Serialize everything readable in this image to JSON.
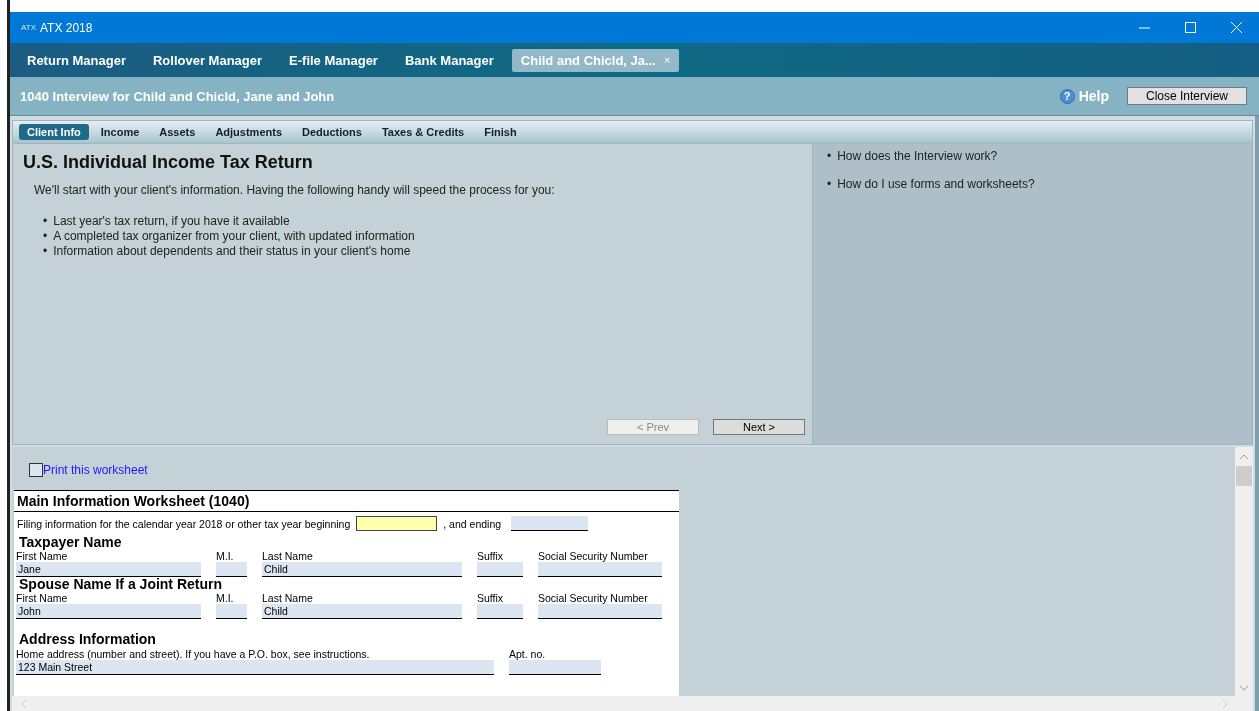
{
  "window": {
    "logo_text": "ATX",
    "title": "ATX 2018"
  },
  "tabs": [
    {
      "label": "Return Manager",
      "selected": false,
      "closable": false
    },
    {
      "label": "Rollover Manager",
      "selected": false,
      "closable": false
    },
    {
      "label": "E-file Manager",
      "selected": false,
      "closable": false
    },
    {
      "label": "Bank Manager",
      "selected": false,
      "closable": false
    },
    {
      "label": "Child and Chicld, Ja...",
      "selected": true,
      "closable": true,
      "close_label": "×"
    }
  ],
  "interview": {
    "title": "1040 Interview for Child and Chicld, Jane and John",
    "help_icon": "?",
    "help": "Help",
    "close_button": "Close Interview"
  },
  "section_tabs": [
    {
      "label": "Client Info",
      "selected": true
    },
    {
      "label": "Income",
      "selected": false
    },
    {
      "label": "Assets",
      "selected": false
    },
    {
      "label": "Adjustments",
      "selected": false
    },
    {
      "label": "Deductions",
      "selected": false
    },
    {
      "label": "Taxes & Credits",
      "selected": false
    },
    {
      "label": "Finish",
      "selected": false
    }
  ],
  "intro": {
    "heading": "U.S. Individual Income Tax Return",
    "text": "We'll start with your client's information. Having the following handy will speed the process for you:",
    "bullet_marker": "•",
    "bullets": [
      "Last year's tax return, if you have it available",
      "A completed tax organizer from your client, with updated information",
      "Information about dependents and their status in your client's home"
    ]
  },
  "nav_buttons": [
    {
      "label": "< Prev",
      "disabled": true
    },
    {
      "label": "Next >",
      "disabled": false
    }
  ],
  "help_marker": "•",
  "help_links": [
    "How does the Interview work?",
    "How do I use forms and worksheets?"
  ],
  "worksheet": {
    "print": {
      "label": "Print this worksheet",
      "checked": false
    },
    "title": "Main Information Worksheet (1040)",
    "filing": {
      "label": "Filing information for the calendar year 2018 or other tax year beginning",
      "beginning": {
        "focused": true
      },
      "ending_label": ", and ending",
      "ending": {
        "focused": false
      }
    },
    "name_sections": [
      {
        "heading": "Taxpayer Name",
        "fields": [
          {
            "label": "First Name",
            "value": "Jane"
          },
          {
            "label": "M.I."
          },
          {
            "label": "Last Name",
            "value": "Child"
          },
          {
            "label": "Suffix"
          },
          {
            "label": "Social Security Number"
          }
        ]
      },
      {
        "heading": "Spouse Name If a Joint Return",
        "fields": [
          {
            "label": "First Name",
            "value": "John"
          },
          {
            "label": "M.I."
          },
          {
            "label": "Last Name",
            "value": "Child"
          },
          {
            "label": "Suffix"
          },
          {
            "label": "Social Security Number"
          }
        ]
      }
    ],
    "address": {
      "heading": "Address Information",
      "fields": [
        {
          "label": "Home address (number and street). If you have a P.O. box, see instructions.",
          "value": "123 Main Street"
        },
        {
          "label": "Apt. no."
        }
      ]
    }
  }
}
